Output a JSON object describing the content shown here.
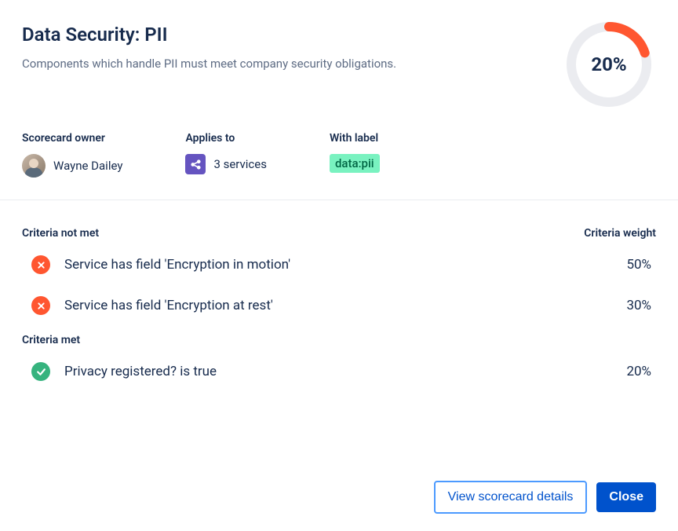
{
  "title": "Data Security: PII",
  "subtitle": "Components which handle PII must meet company security obligations.",
  "progress": {
    "value": 20,
    "display": "20%",
    "color": "#FF5630",
    "track": "#EBECF0"
  },
  "meta": {
    "owner_label": "Scorecard owner",
    "owner_name": "Wayne Dailey",
    "applies_label": "Applies to",
    "applies_text": "3 services",
    "withlabel_label": "With label",
    "label_chip": "data:pii"
  },
  "criteria": {
    "not_met_header": "Criteria not met",
    "weight_header": "Criteria weight",
    "met_header": "Criteria met",
    "not_met": [
      {
        "text": "Service has field 'Encryption in motion'",
        "weight": "50%"
      },
      {
        "text": "Service has field 'Encryption at rest'",
        "weight": "30%"
      }
    ],
    "met": [
      {
        "text": "Privacy registered? is true",
        "weight": "20%"
      }
    ]
  },
  "buttons": {
    "view_details": "View scorecard details",
    "close": "Close"
  }
}
